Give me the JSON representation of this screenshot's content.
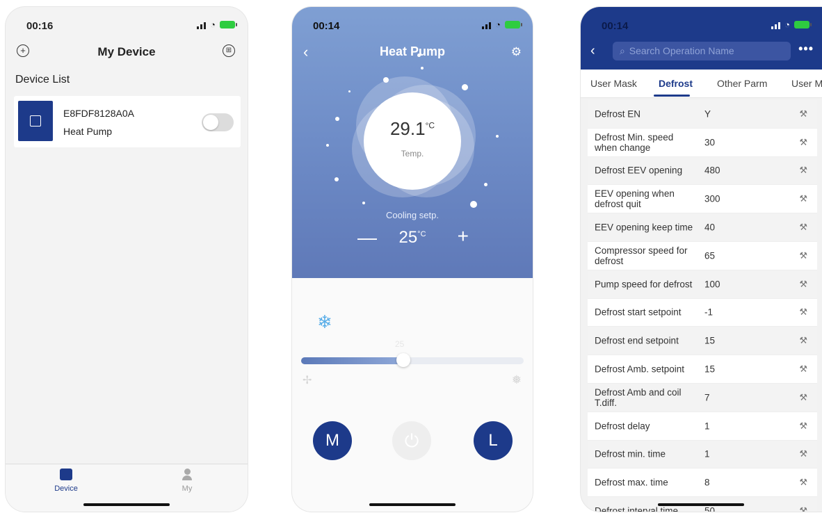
{
  "screen1": {
    "status_time": "00:16",
    "title": "My Device",
    "list_title": "Device List",
    "device": {
      "id": "E8FDF8128A0A",
      "type": "Heat Pump"
    },
    "tabs": [
      {
        "label": "Device",
        "active": true
      },
      {
        "label": "My",
        "active": false
      }
    ]
  },
  "screen2": {
    "status_time": "00:14",
    "title": "Heat Pump",
    "temp_value": "29.1",
    "temp_unit": "°C",
    "temp_label": "Temp.",
    "setpoint_label": "Cooling setp.",
    "setpoint_value": "25",
    "setpoint_unit": "°C",
    "slider_value": "25",
    "slider_level": 0.46,
    "mode_buttons": {
      "left": "M",
      "right": "L"
    },
    "colors": {
      "accent": "#1d3a8a",
      "snow": "#5aaee8"
    }
  },
  "screen3": {
    "status_time": "00:14",
    "search_placeholder": "Search Operation Name",
    "tabs": [
      "User Mask",
      "Defrost",
      "Other Parm",
      "User M"
    ],
    "active_tab": "Defrost",
    "rows": [
      {
        "name": "Defrost EN",
        "value": "Y"
      },
      {
        "name": "Defrost Min. speed when change",
        "value": "30"
      },
      {
        "name": "Defrost EEV opening",
        "value": "480"
      },
      {
        "name": "EEV opening when defrost quit",
        "value": "300"
      },
      {
        "name": "EEV opening keep time",
        "value": "40"
      },
      {
        "name": "Compressor speed for defrost",
        "value": "65"
      },
      {
        "name": "Pump speed for defrost",
        "value": "100"
      },
      {
        "name": "Defrost start setpoint",
        "value": "-1"
      },
      {
        "name": "Defrost end setpoint",
        "value": "15"
      },
      {
        "name": "Defrost Amb. setpoint",
        "value": "15"
      },
      {
        "name": "Defrost Amb and coil T.diff.",
        "value": "7"
      },
      {
        "name": "Defrost delay",
        "value": "1"
      },
      {
        "name": "Defrost min. time",
        "value": "1"
      },
      {
        "name": "Defrost max. time",
        "value": "8"
      },
      {
        "name": "Defrost interval time",
        "value": "50"
      }
    ]
  }
}
